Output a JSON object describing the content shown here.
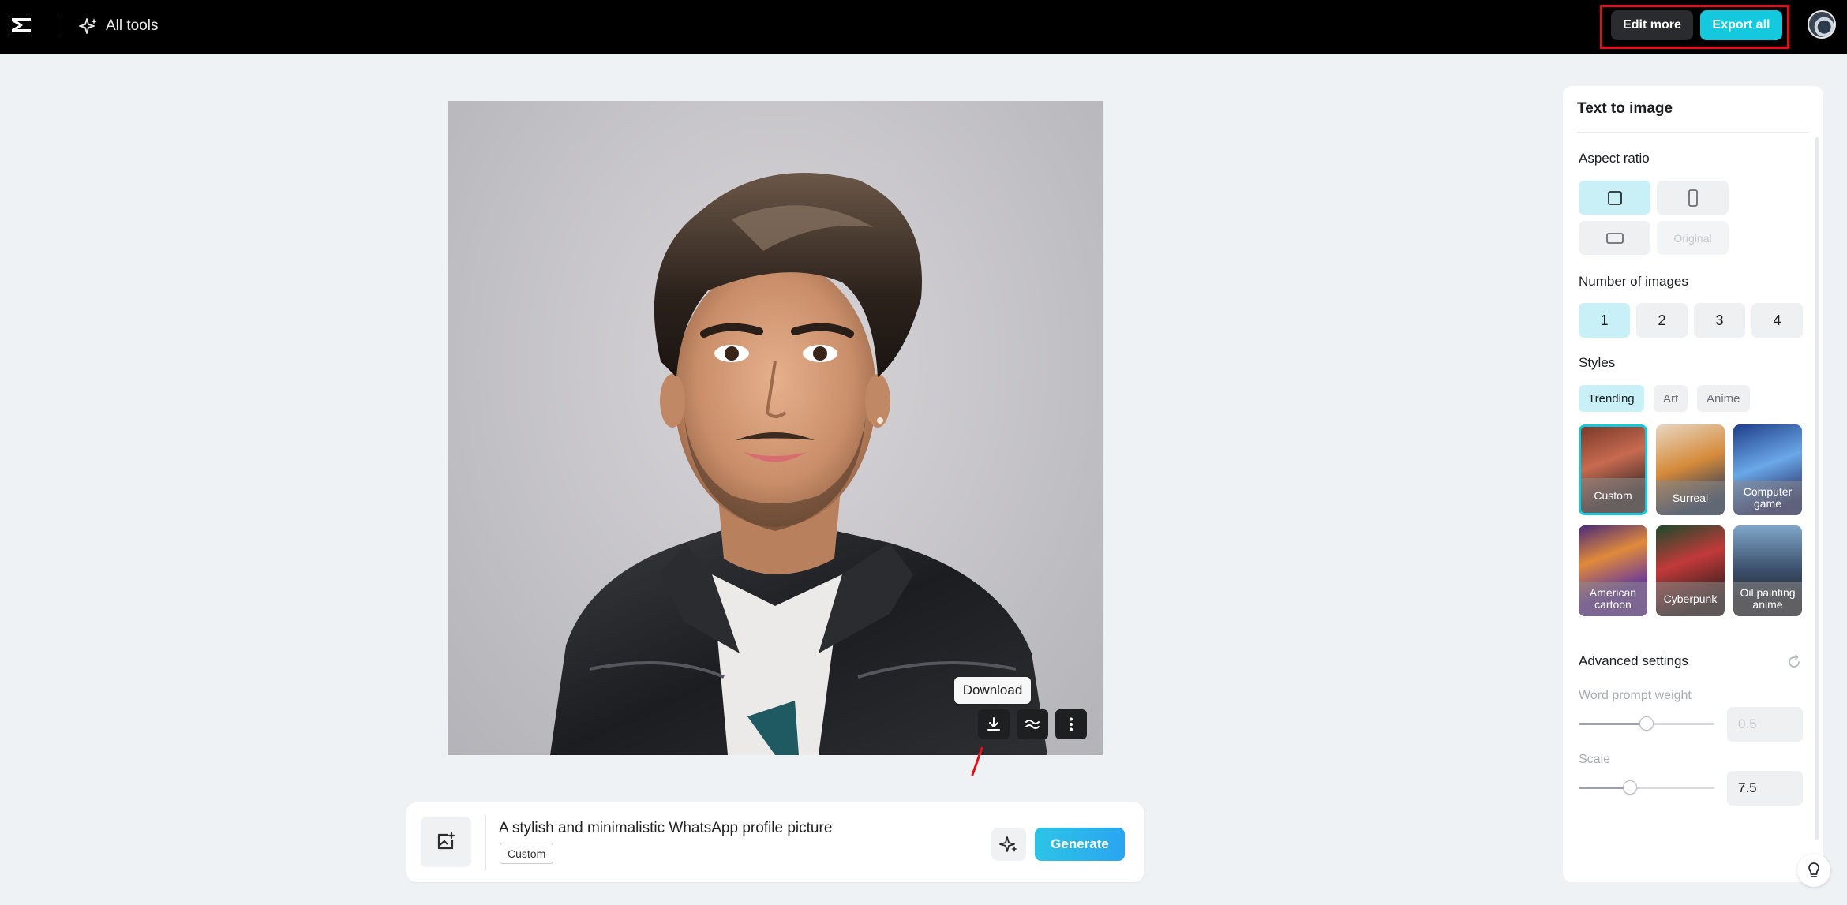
{
  "header": {
    "all_tools_label": "All tools",
    "edit_more_label": "Edit more",
    "export_all_label": "Export all"
  },
  "canvas": {
    "tooltip": "Download",
    "tools": [
      "download-icon",
      "wave-icon",
      "more-vertical-icon"
    ]
  },
  "prompt": {
    "text": "A stylish and minimalistic WhatsApp profile picture",
    "style_tag": "Custom",
    "generate_label": "Generate"
  },
  "panel": {
    "title": "Text to image",
    "aspect_ratio": {
      "label": "Aspect ratio",
      "options": [
        "square",
        "portrait",
        "landscape",
        "Original"
      ],
      "selected": "square"
    },
    "number_of_images": {
      "label": "Number of images",
      "options": [
        "1",
        "2",
        "3",
        "4"
      ],
      "selected": "1"
    },
    "styles": {
      "label": "Styles",
      "tabs": [
        "Trending",
        "Art",
        "Anime"
      ],
      "selected_tab": "Trending",
      "cards": [
        {
          "label": "Custom",
          "selected": true
        },
        {
          "label": "Surreal",
          "selected": false
        },
        {
          "label": "Computer game",
          "selected": false
        },
        {
          "label": "American cartoon",
          "selected": false
        },
        {
          "label": "Cyberpunk",
          "selected": false
        },
        {
          "label": "Oil painting anime",
          "selected": false
        }
      ]
    },
    "advanced": {
      "label": "Advanced settings",
      "word_prompt_weight": {
        "label": "Word prompt weight",
        "value": "0.5",
        "level": 0.5
      },
      "scale": {
        "label": "Scale",
        "value": "7.5",
        "level": 0.38
      }
    }
  },
  "colors": {
    "accent": "#14c9dd",
    "selected_bg": "#c8f0f6",
    "highlight_box": "#e3101a"
  }
}
